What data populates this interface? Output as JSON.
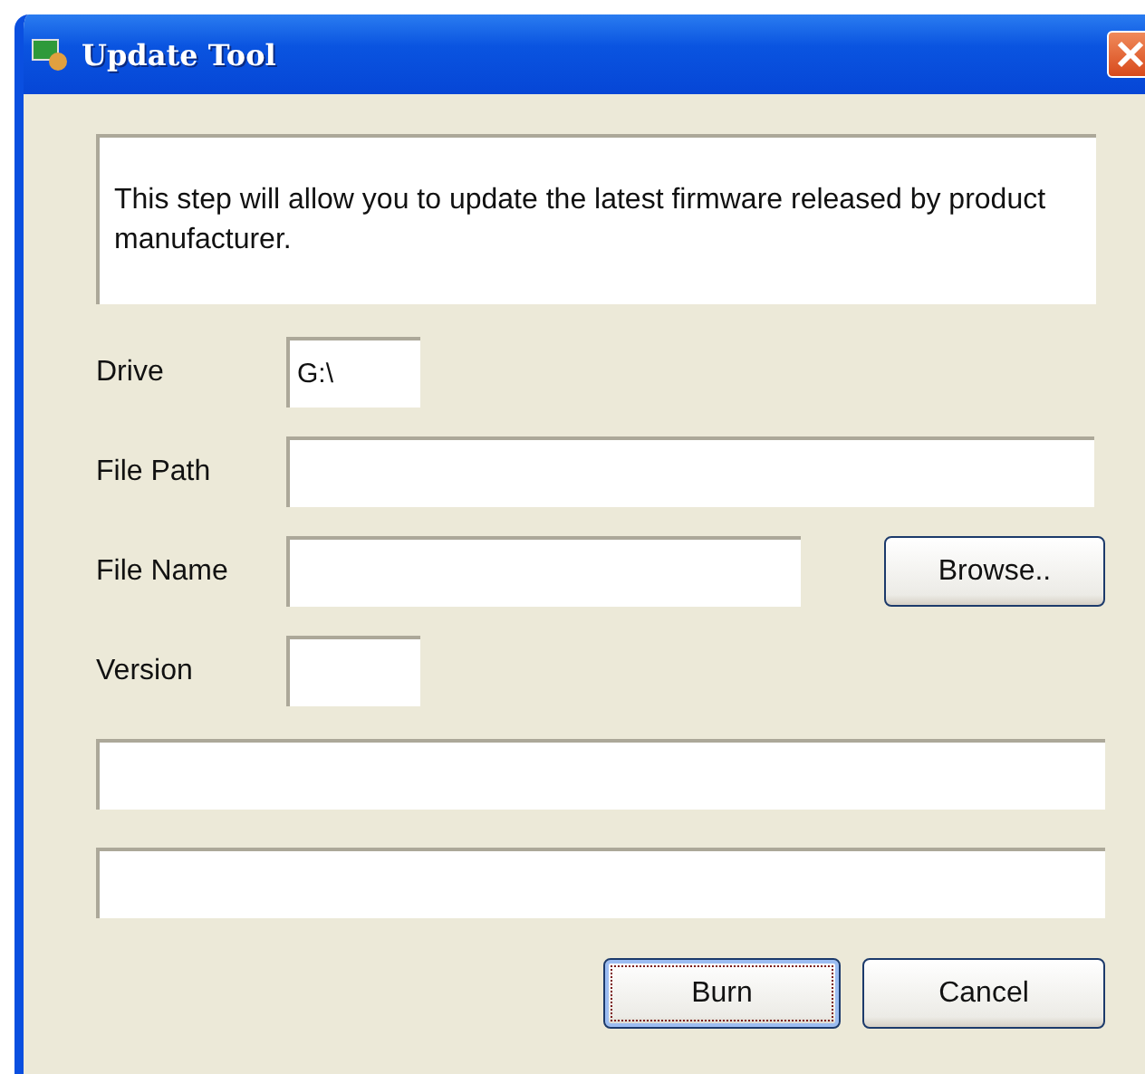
{
  "window": {
    "title": "Update Tool"
  },
  "description": "This step will allow you to update the latest firmware released by product manufacturer.",
  "fields": [
    {
      "label": "Drive",
      "value": "G:\\",
      "kind": "short"
    },
    {
      "label": "File Path",
      "kind": "wide"
    },
    {
      "label": "File Name",
      "kind": "browse",
      "button": "Browse.."
    },
    {
      "label": "Version",
      "kind": "short"
    }
  ],
  "status_lines": [
    {
      "kind": "bar"
    },
    {
      "kind": "bar"
    }
  ],
  "buttons": [
    {
      "label": "Burn",
      "focused": true
    },
    {
      "label": "Cancel",
      "focused": false
    }
  ]
}
